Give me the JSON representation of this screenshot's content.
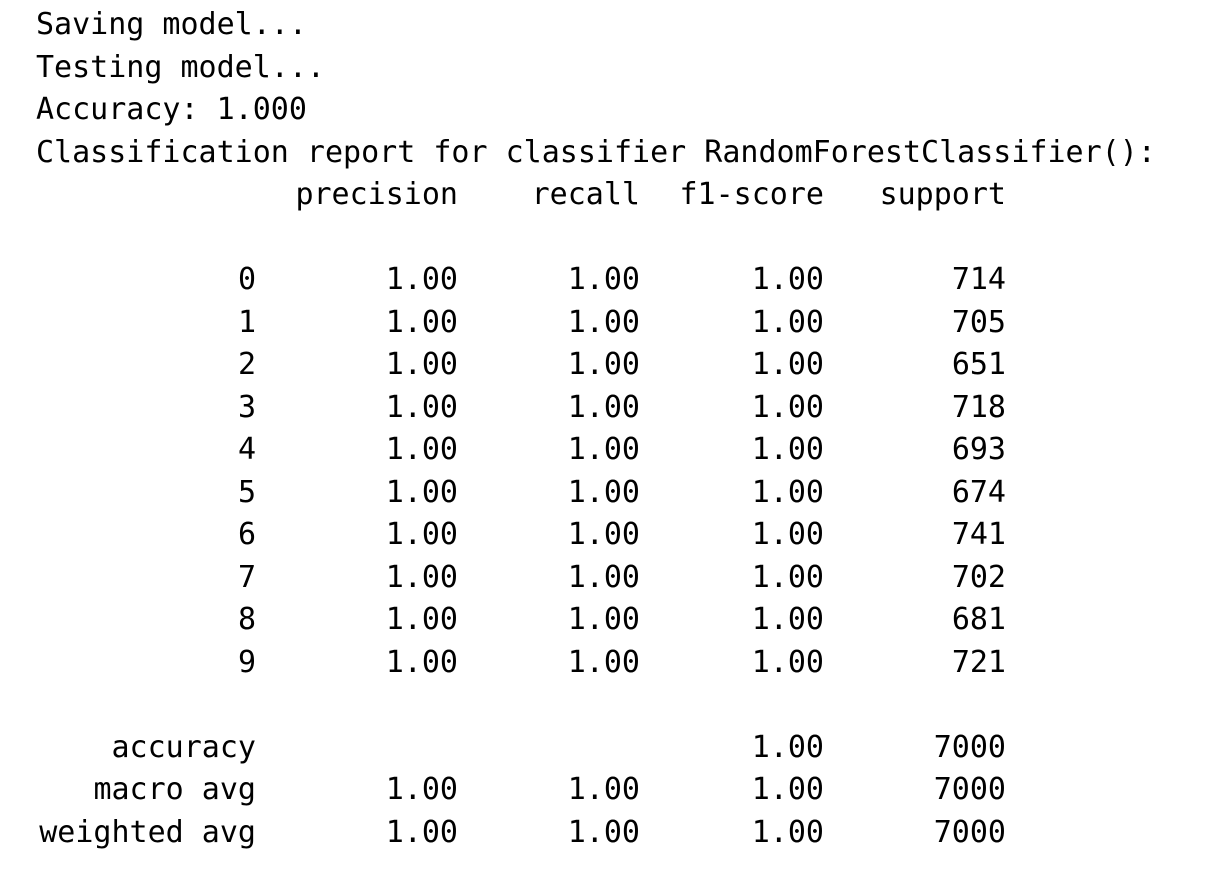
{
  "log_lines": [
    "Saving model...",
    "Testing model...",
    "Accuracy: 1.000",
    "Classification report for classifier RandomForestClassifier():"
  ],
  "report": {
    "headers": [
      "precision",
      "recall",
      "f1-score",
      "support"
    ],
    "class_rows": [
      {
        "label": "0",
        "precision": "1.00",
        "recall": "1.00",
        "f1": "1.00",
        "support": "714"
      },
      {
        "label": "1",
        "precision": "1.00",
        "recall": "1.00",
        "f1": "1.00",
        "support": "705"
      },
      {
        "label": "2",
        "precision": "1.00",
        "recall": "1.00",
        "f1": "1.00",
        "support": "651"
      },
      {
        "label": "3",
        "precision": "1.00",
        "recall": "1.00",
        "f1": "1.00",
        "support": "718"
      },
      {
        "label": "4",
        "precision": "1.00",
        "recall": "1.00",
        "f1": "1.00",
        "support": "693"
      },
      {
        "label": "5",
        "precision": "1.00",
        "recall": "1.00",
        "f1": "1.00",
        "support": "674"
      },
      {
        "label": "6",
        "precision": "1.00",
        "recall": "1.00",
        "f1": "1.00",
        "support": "741"
      },
      {
        "label": "7",
        "precision": "1.00",
        "recall": "1.00",
        "f1": "1.00",
        "support": "702"
      },
      {
        "label": "8",
        "precision": "1.00",
        "recall": "1.00",
        "f1": "1.00",
        "support": "681"
      },
      {
        "label": "9",
        "precision": "1.00",
        "recall": "1.00",
        "f1": "1.00",
        "support": "721"
      }
    ],
    "summary_rows": [
      {
        "label": "accuracy",
        "precision": "",
        "recall": "",
        "f1": "1.00",
        "support": "7000"
      },
      {
        "label": "macro avg",
        "precision": "1.00",
        "recall": "1.00",
        "f1": "1.00",
        "support": "7000"
      },
      {
        "label": "weighted avg",
        "precision": "1.00",
        "recall": "1.00",
        "f1": "1.00",
        "support": "7000"
      }
    ]
  }
}
